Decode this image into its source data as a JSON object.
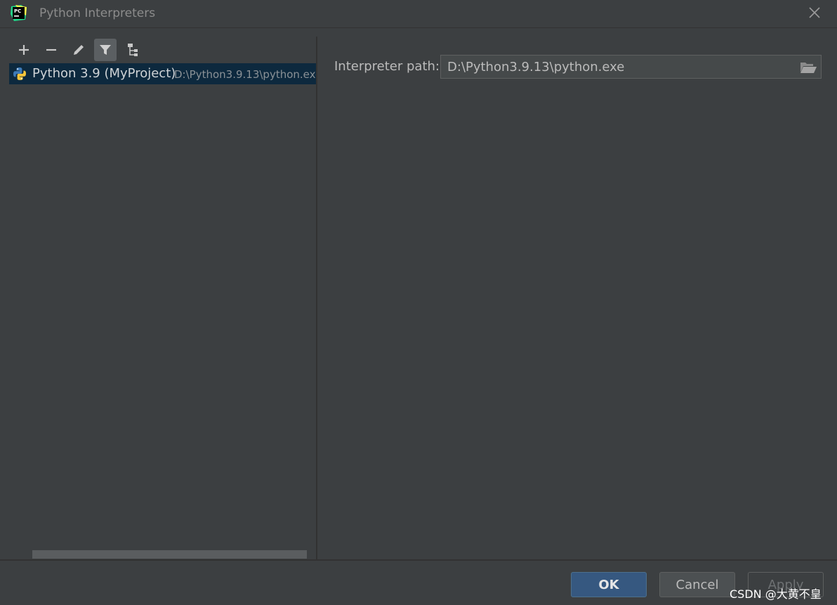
{
  "window": {
    "title": "Python Interpreters",
    "app_logo_text": "PC",
    "close_icon": "close-icon"
  },
  "toolbar": {
    "items": [
      {
        "name": "add-icon",
        "active": false
      },
      {
        "name": "remove-icon",
        "active": false
      },
      {
        "name": "edit-icon",
        "active": false
      },
      {
        "name": "filter-icon",
        "active": true
      },
      {
        "name": "show-paths-tree-icon",
        "active": false
      }
    ]
  },
  "interpreters": [
    {
      "name": "Python 3.9 (MyProject)",
      "path": "D:\\Python3.9.13\\python.exe",
      "icon": "python-icon",
      "selected": true
    }
  ],
  "details": {
    "path_label": "Interpreter path:",
    "path_value": "D:\\Python3.9.13\\python.exe",
    "browse_icon": "folder-open-icon"
  },
  "buttons": {
    "ok": "OK",
    "cancel": "Cancel",
    "apply": "Apply"
  },
  "watermark": "CSDN @大黄不皇",
  "colors": {
    "background": "#3c3f41",
    "selection": "#0d293e",
    "primary_button": "#365880"
  }
}
